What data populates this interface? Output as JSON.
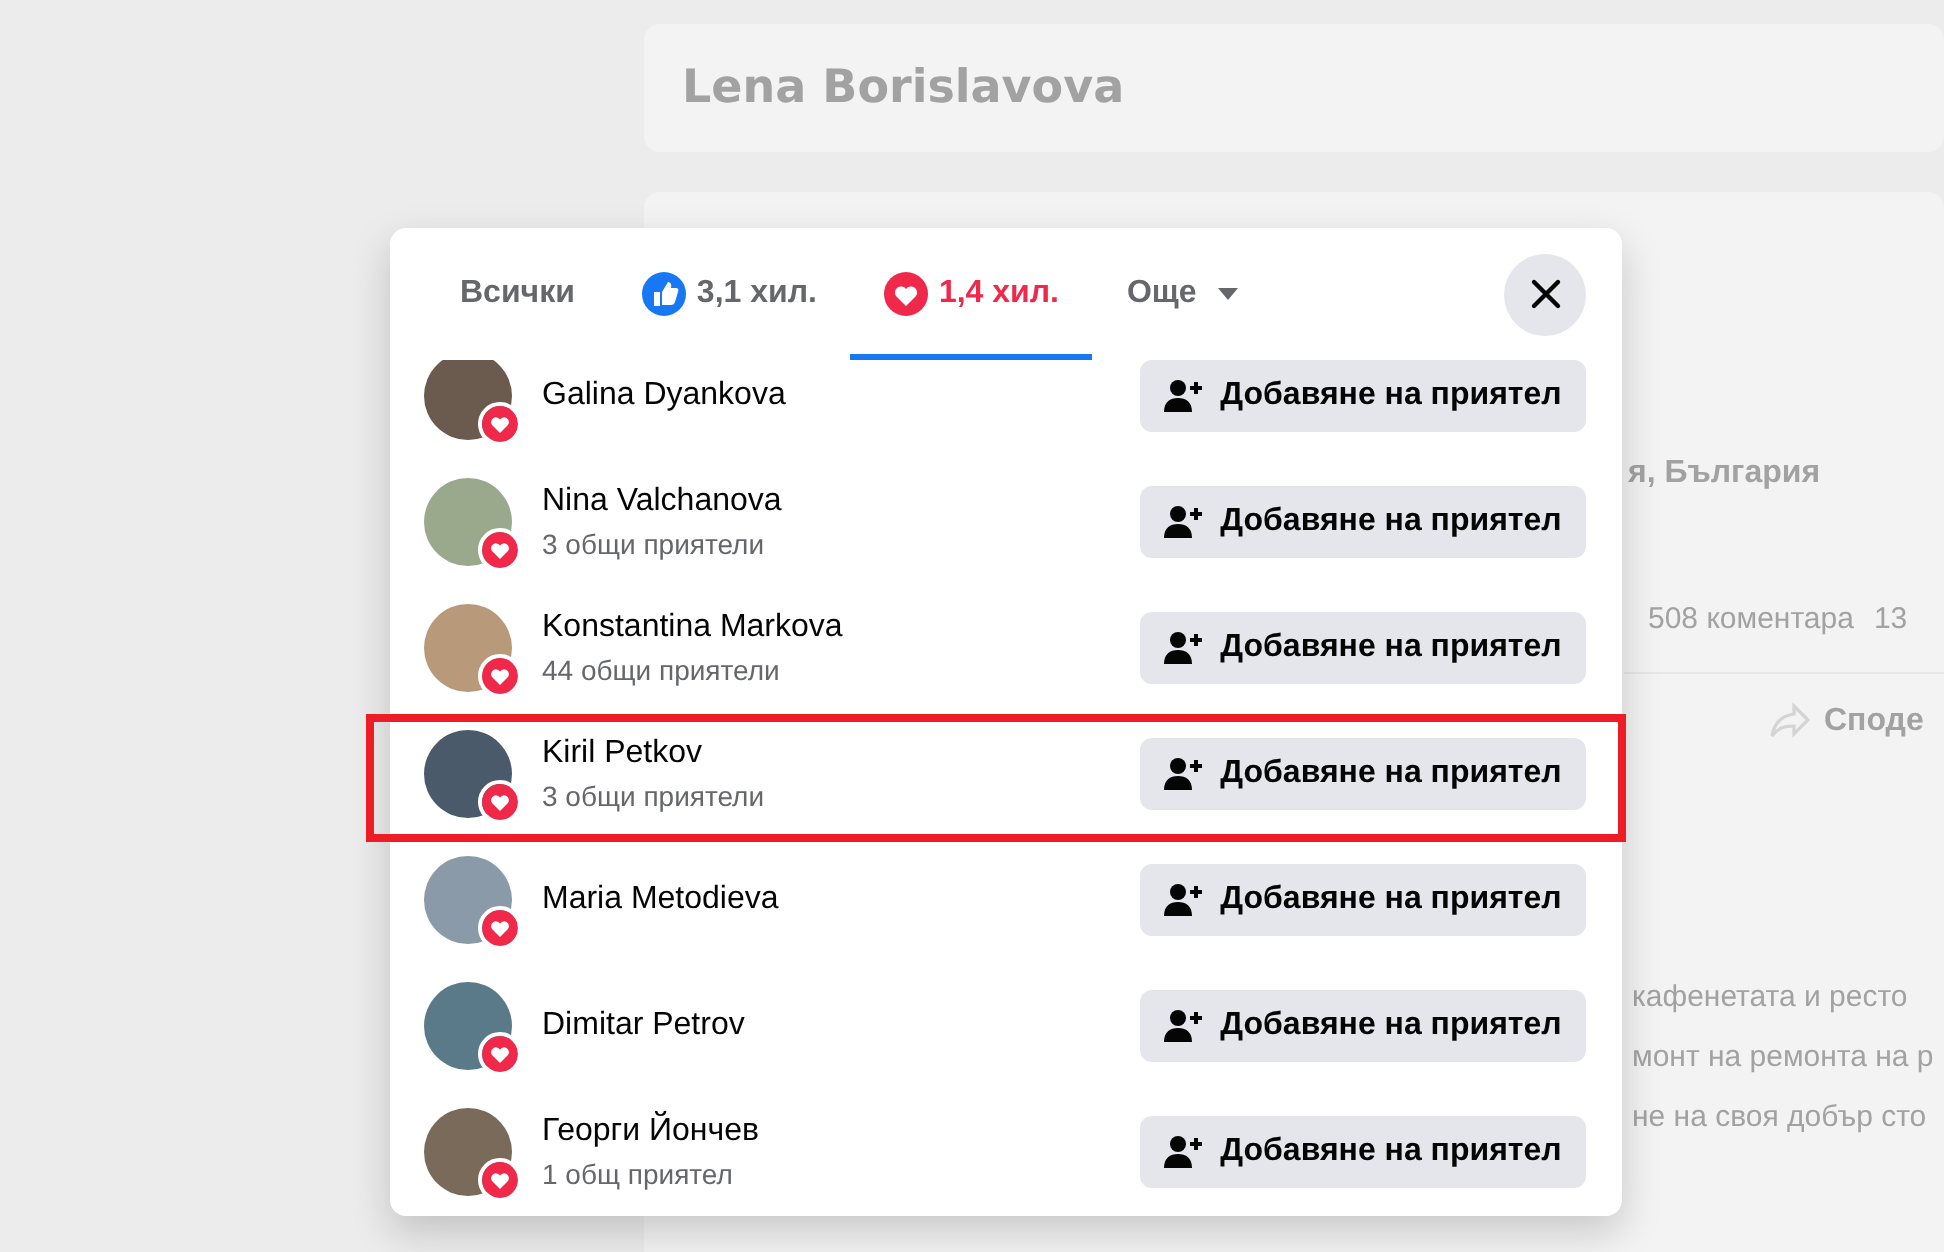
{
  "background": {
    "profile_name": "Lena Borislavova",
    "location_fragment": "я, България",
    "comments_fragment": "508 коментара",
    "count_fragment": "13",
    "share_fragment": "Споде",
    "text_lines": [
      "кафенетата и ресто",
      "монт на ремонта на р",
      "не на своя добър сто"
    ]
  },
  "dialog": {
    "tabs": [
      {
        "kind": "text",
        "label": "Всички",
        "selected": false
      },
      {
        "kind": "like",
        "label": "3,1 хил.",
        "selected": false
      },
      {
        "kind": "love",
        "label": "1,4 хил.",
        "selected": true
      },
      {
        "kind": "more",
        "label": "Още",
        "selected": false
      }
    ],
    "people": [
      {
        "name": "Galina Dyankova",
        "highlighted": false,
        "button": "Добавяне на приятел"
      },
      {
        "name": "Nina Valchanova",
        "mutual": "3 общи приятели",
        "highlighted": false,
        "button": "Добавяне на приятел"
      },
      {
        "name": "Konstantina Markova",
        "mutual": "44 общи приятели",
        "highlighted": false,
        "button": "Добавяне на приятел"
      },
      {
        "name": "Kiril Petkov",
        "mutual": "3 общи приятели",
        "highlighted": true,
        "button": "Добавяне на приятел"
      },
      {
        "name": "Maria Metodieva",
        "highlighted": false,
        "button": "Добавяне на приятел"
      },
      {
        "name": "Dimitar Petrov",
        "highlighted": false,
        "button": "Добавяне на приятел"
      },
      {
        "name": "Георги Йончев",
        "mutual": "1 общ приятел",
        "highlighted": false,
        "button": "Добавяне на приятел"
      }
    ]
  }
}
